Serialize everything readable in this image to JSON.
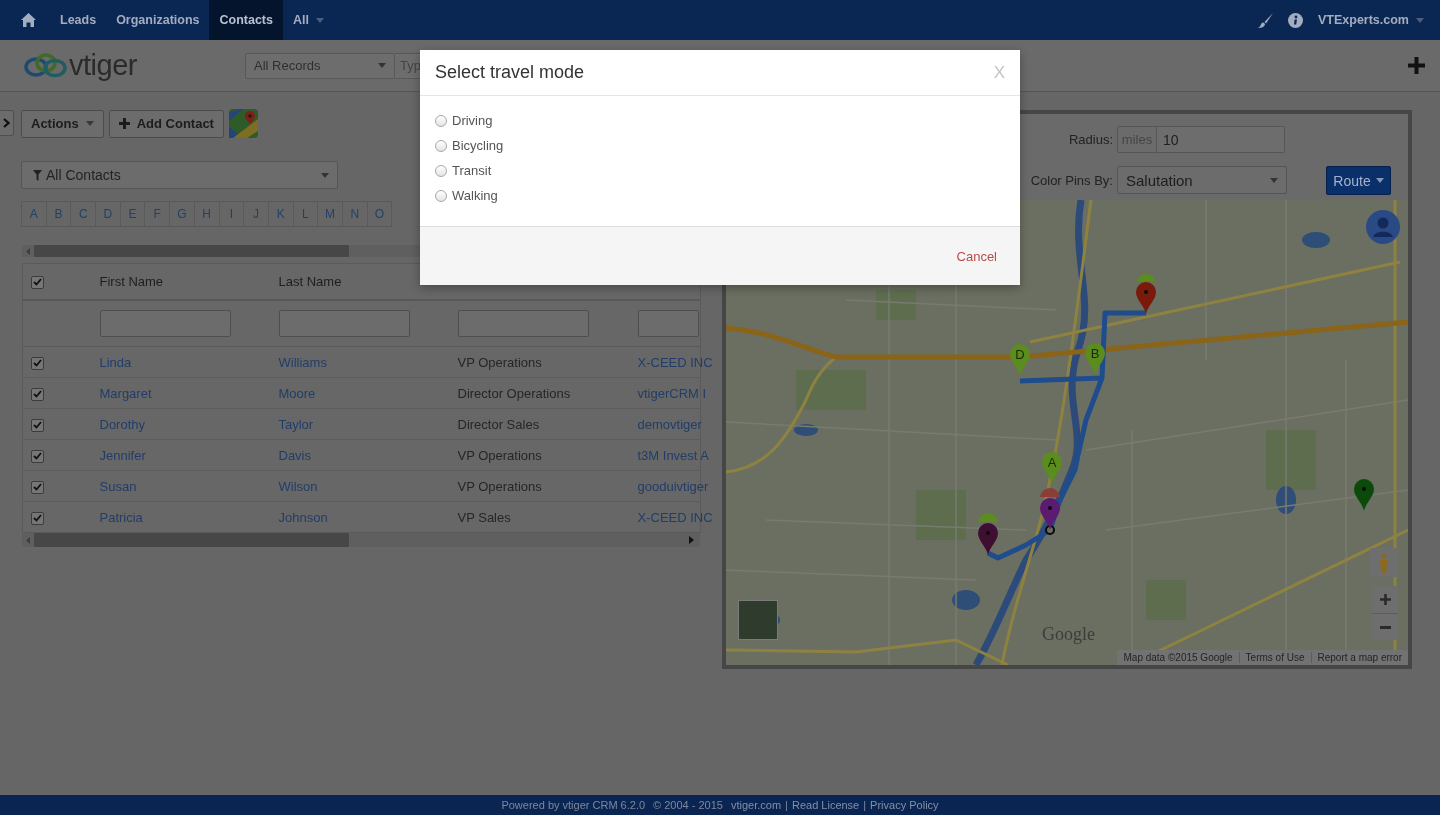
{
  "navbar": {
    "tabs": [
      {
        "label": "Leads",
        "selected": false,
        "dropdown": false
      },
      {
        "label": "Organizations",
        "selected": false,
        "dropdown": false
      },
      {
        "label": "Contacts",
        "selected": true,
        "dropdown": false
      },
      {
        "label": "All",
        "selected": false,
        "dropdown": true
      }
    ],
    "user": "VTExperts.com"
  },
  "header": {
    "logo": "vtiger",
    "record_filter": "All Records",
    "search_placeholder": "Typ"
  },
  "toolbar": {
    "actions": "Actions",
    "add_button": "Add Contact"
  },
  "list_filter": "All Contacts",
  "alphabet": [
    "A",
    "B",
    "C",
    "D",
    "E",
    "F",
    "G",
    "H",
    "I",
    "J",
    "K",
    "L",
    "M",
    "N",
    "O"
  ],
  "table": {
    "columns": [
      {
        "label": "First Name",
        "kind": "link"
      },
      {
        "label": "Last Name",
        "kind": "link"
      },
      {
        "kind": "text"
      },
      {
        "kind": "link"
      }
    ],
    "all_checked": true,
    "rows": [
      {
        "checked": true,
        "cells": [
          "Linda",
          "Williams",
          "VP Operations",
          "X-CEED INC"
        ]
      },
      {
        "checked": true,
        "cells": [
          "Margaret",
          "Moore",
          "Director Operations",
          "vtigerCRM I"
        ]
      },
      {
        "checked": true,
        "cells": [
          "Dorothy",
          "Taylor",
          "Director Sales",
          "demovtiger"
        ]
      },
      {
        "checked": true,
        "cells": [
          "Jennifer",
          "Davis",
          "VP Operations",
          "t3M Invest A"
        ]
      },
      {
        "checked": true,
        "cells": [
          "Susan",
          "Wilson",
          "VP Operations",
          "gooduivtiger"
        ]
      },
      {
        "checked": true,
        "cells": [
          "Patricia",
          "Johnson",
          "VP Sales",
          "X-CEED INC"
        ]
      }
    ]
  },
  "map_panel": {
    "radius_label": "Radius:",
    "radius_unit": "miles",
    "radius_value": "10",
    "color_label": "Color Pins By:",
    "color_value": "Salutation",
    "route_button": "Route"
  },
  "map": {
    "pins": [
      {
        "color": "#5a8c1e"
      },
      {
        "color": "#7a1a0a",
        "dot": true
      },
      {
        "label": "D",
        "color": "#5a8c1e",
        "dot": false
      },
      {
        "label": "B",
        "color": "#5a8c1e",
        "dot": false
      },
      {
        "label": "A",
        "color": "#5a8c1e",
        "dot": false
      },
      {
        "color": "#8a3e36"
      },
      {
        "color": "#5c1a70",
        "dot": true
      },
      {
        "color": "#5a8c1e"
      },
      {
        "color": "#3e0f30",
        "dot": true
      },
      {
        "color": "#0c4a0c",
        "dot": true
      }
    ],
    "logo": "Google",
    "attribution": [
      "Map data ©2015 Google",
      "Terms of Use",
      "Report a map error"
    ]
  },
  "modal": {
    "title": "Select travel mode",
    "close": "X",
    "options": [
      {
        "label": "Driving",
        "selected": false
      },
      {
        "label": "Bicycling",
        "selected": false
      },
      {
        "label": "Transit",
        "selected": false
      },
      {
        "label": "Walking",
        "selected": false
      }
    ],
    "cancel": "Cancel"
  },
  "footer": {
    "items": [
      {
        "kind": "text",
        "text": "Powered by vtiger CRM 6.2.0"
      },
      {
        "kind": "text",
        "text": "© 2004 - 2015"
      },
      {
        "kind": "link",
        "text": "vtiger.com"
      },
      {
        "kind": "separator",
        "text": "|"
      },
      {
        "kind": "link",
        "text": "Read License"
      },
      {
        "kind": "separator",
        "text": "|"
      },
      {
        "kind": "link",
        "text": "Privacy Policy"
      }
    ]
  }
}
